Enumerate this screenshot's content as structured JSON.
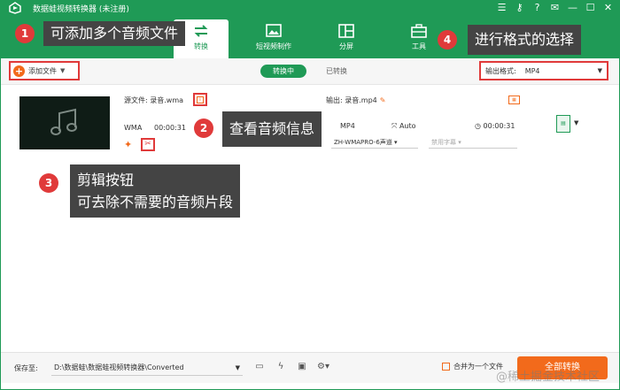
{
  "window": {
    "title": "数据蛙视频转换器 (未注册)",
    "controls": [
      "menu",
      "key",
      "help",
      "feedback",
      "minimize",
      "maximize",
      "close"
    ]
  },
  "nav": {
    "tabs": [
      {
        "label": "转换",
        "icon": "convert-icon",
        "active": true
      },
      {
        "label": "短视频制作",
        "icon": "short-video-icon",
        "active": false
      },
      {
        "label": "分屏",
        "icon": "split-screen-icon",
        "active": false
      },
      {
        "label": "工具",
        "icon": "toolbox-icon",
        "active": false
      }
    ]
  },
  "toolbar": {
    "add_file_label": "添加文件",
    "converting_label": "转换中",
    "converted_label": "已转换",
    "output_format_label": "输出格式:",
    "output_format_value": "MP4"
  },
  "file": {
    "source_label": "源文件: 录音.wma",
    "codec": "WMA",
    "duration": "00:00:31",
    "output_label": "输出: 录音.mp4",
    "out_format": "MP4",
    "resolution": "Auto",
    "out_duration": "00:00:31",
    "audio_track": "ZH-WMAPRO-6声道",
    "subtitle": "禁用字幕"
  },
  "annotations": [
    {
      "num": "1",
      "text": "可添加多个音频文件"
    },
    {
      "num": "2",
      "text": "查看音频信息"
    },
    {
      "num": "3",
      "text_line1": "剪辑按钮",
      "text_line2": "可去除不需要的音频片段"
    },
    {
      "num": "4",
      "text": "进行格式的选择"
    }
  ],
  "bottom": {
    "save_label": "保存至:",
    "path": "D:\\数据蛙\\数据蛙视频转换器\\Converted",
    "merge_label": "合并为一个文件",
    "convert_all_label": "全部转换"
  },
  "watermark": "@稀土掘金技术社区",
  "colors": {
    "brand": "#1f9a56",
    "accent": "#f26a1b",
    "highlight": "#e03a3a"
  }
}
